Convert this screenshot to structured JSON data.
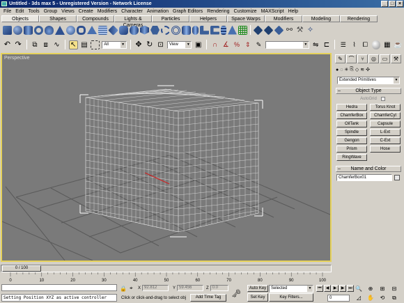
{
  "window": {
    "title": "Untitled - 3ds max 5 - Unregistered Version - Network License"
  },
  "menu": [
    "File",
    "Edit",
    "Tools",
    "Group",
    "Views",
    "Create",
    "Modifiers",
    "Character",
    "Animation",
    "Graph Editors",
    "Rendering",
    "Customize",
    "MAXScript",
    "Help"
  ],
  "tabs": [
    "Objects",
    "Shapes",
    "Compounds",
    "Lights & Cameras",
    "Particles",
    "Helpers",
    "Space Warps",
    "Modifiers",
    "Modeling",
    "Rendering"
  ],
  "toolbar": {
    "selection_filter": "All",
    "reference_coord": "View"
  },
  "viewport": {
    "label": "Perspective"
  },
  "command_panel": {
    "category": "Extended Primitives",
    "object_type_title": "Object Type",
    "autogrid_label": "AutoGrid",
    "buttons": [
      "Hedra",
      "Torus Knot",
      "ChamferBox",
      "ChamferCyl",
      "OilTank",
      "Capsule",
      "Spindle",
      "L-Ext",
      "Gengon",
      "C-Ext",
      "Prism",
      "Hose",
      "RingWave"
    ],
    "name_color_title": "Name and Color",
    "object_name": "ChamferBox01"
  },
  "timeline": {
    "slider_label": "0 / 100",
    "ticks": [
      "0",
      "10",
      "20",
      "30",
      "40",
      "50",
      "60",
      "70",
      "80",
      "90",
      "100"
    ]
  },
  "status": {
    "script_line": "Setting Position XYZ as active controller",
    "x_label": "X",
    "x_value": "92.812",
    "y_label": "Y",
    "y_value": "59.456",
    "z_label": "Z",
    "z_value": "0.0",
    "prompt": "Click or click-and-drag to select obj",
    "add_time_tag": "Add Time Tag",
    "auto_key": "Auto Key",
    "set_key": "Set Key",
    "selected": "Selected",
    "key_filters": "Key Filters...",
    "current_frame": "0"
  }
}
